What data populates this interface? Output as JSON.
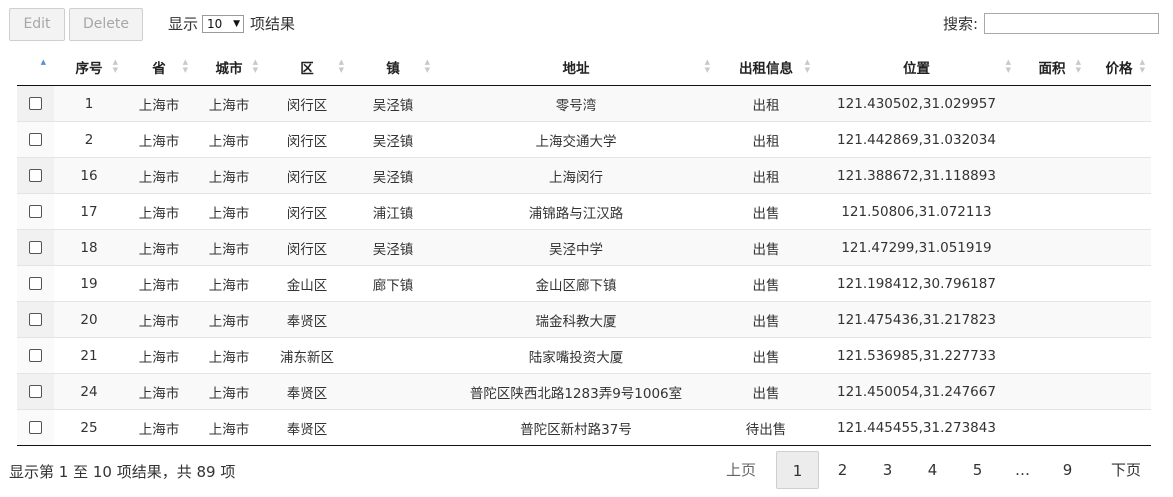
{
  "toolbar": {
    "edit_label": "Edit",
    "delete_label": "Delete"
  },
  "length": {
    "prefix": "显示",
    "selected": "10",
    "suffix": "项结果"
  },
  "search": {
    "label": "搜索:",
    "value": ""
  },
  "columns": [
    "",
    "序号",
    "省",
    "城市",
    "区",
    "镇",
    "地址",
    "出租信息",
    "位置",
    "面积",
    "价格"
  ],
  "rows": [
    [
      "1",
      "上海市",
      "上海市",
      "闵行区",
      "吴泾镇",
      "零号湾",
      "出租",
      "121.430502,31.029957",
      "",
      ""
    ],
    [
      "2",
      "上海市",
      "上海市",
      "闵行区",
      "吴泾镇",
      "上海交通大学",
      "出租",
      "121.442869,31.032034",
      "",
      ""
    ],
    [
      "16",
      "上海市",
      "上海市",
      "闵行区",
      "吴泾镇",
      "上海闵行",
      "出租",
      "121.388672,31.118893",
      "",
      ""
    ],
    [
      "17",
      "上海市",
      "上海市",
      "闵行区",
      "浦江镇",
      "浦锦路与江汉路",
      "出售",
      "121.50806,31.072113",
      "",
      ""
    ],
    [
      "18",
      "上海市",
      "上海市",
      "闵行区",
      "吴泾镇",
      "吴泾中学",
      "出售",
      "121.47299,31.051919",
      "",
      ""
    ],
    [
      "19",
      "上海市",
      "上海市",
      "金山区",
      "廊下镇",
      "金山区廊下镇",
      "出售",
      "121.198412,30.796187",
      "",
      ""
    ],
    [
      "20",
      "上海市",
      "上海市",
      "奉贤区",
      "",
      "瑞金科教大厦",
      "出售",
      "121.475436,31.217823",
      "",
      ""
    ],
    [
      "21",
      "上海市",
      "上海市",
      "浦东新区",
      "",
      "陆家嘴投资大厦",
      "出售",
      "121.536985,31.227733",
      "",
      ""
    ],
    [
      "24",
      "上海市",
      "上海市",
      "奉贤区",
      "",
      "普陀区陕西北路1283弄9号1006室",
      "出售",
      "121.450054,31.247667",
      "",
      ""
    ],
    [
      "25",
      "上海市",
      "上海市",
      "奉贤区",
      "",
      "普陀区新村路37号",
      "待出售",
      "121.445455,31.273843",
      "",
      ""
    ]
  ],
  "footer": {
    "info": "显示第 1 至 10 项结果，共 89 项"
  },
  "pagination": {
    "prev": "上页",
    "pages": [
      "1",
      "2",
      "3",
      "4",
      "5",
      "…",
      "9"
    ],
    "current": "1",
    "next": "下页"
  },
  "colors": {
    "sort_active": "#5b8fd3",
    "header_border": "#111111",
    "row_stripe": "#f9f9f9"
  }
}
